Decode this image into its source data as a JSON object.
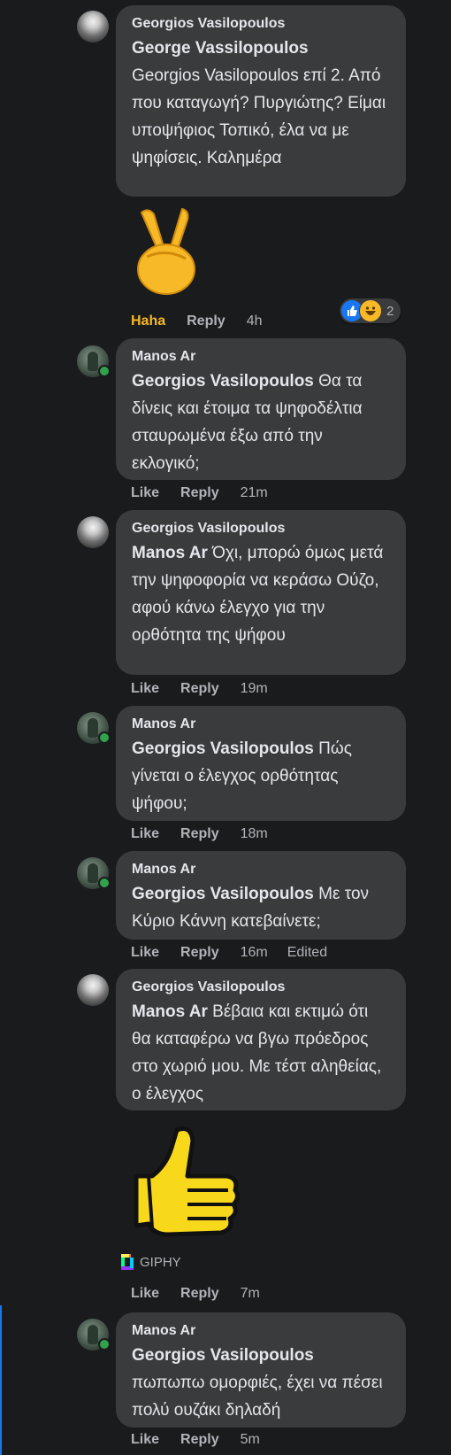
{
  "comments": [
    {
      "author": "Georgios Vasilopoulos",
      "mention": "George Vassilopoulos",
      "text": "Georgios Vasilopoulos επί 2. Από που καταγωγή? Πυργιώτης? Είμαι υποψήφιος Τοπικό, έλα να με ψηφίσεις. Καλημέρα",
      "actions": {
        "react": "Haha",
        "reply": "Reply",
        "time": "4h"
      },
      "reaction_count": "2"
    },
    {
      "author": "Manos Ar",
      "mention": "Georgios Vasilopoulos",
      "text": "Θα τα δίνεις και έτοιμα τα ψηφοδέλτια σταυρωμένα έξω από την εκλογικό;",
      "actions": {
        "react": "Like",
        "reply": "Reply",
        "time": "21m"
      }
    },
    {
      "author": "Georgios Vasilopoulos",
      "mention": "Manos Ar",
      "text": "Όχι, μπορώ όμως μετά την ψηφοφορία να κεράσω Ούζο, αφού κάνω έλεγχο για την ορθότητα της ψήφου",
      "actions": {
        "react": "Like",
        "reply": "Reply",
        "time": "19m"
      }
    },
    {
      "author": "Manos Ar",
      "mention": "Georgios Vasilopoulos",
      "text": "Πώς γίνεται ο έλεγχος ορθότητας ψήφου;",
      "actions": {
        "react": "Like",
        "reply": "Reply",
        "time": "18m"
      }
    },
    {
      "author": "Manos Ar",
      "mention": "Georgios Vasilopoulos",
      "text": "Με τον Κύριο Κάννη κατεβαίνετε;",
      "actions": {
        "react": "Like",
        "reply": "Reply",
        "time": "16m",
        "edited": "Edited"
      }
    },
    {
      "author": "Georgios Vasilopoulos",
      "mention": "Manos Ar",
      "text": "Βέβαια και εκτιμώ ότι θα καταφέρω να βγω πρόεδρος στο χωριό μου. Με τέστ αληθείας, ο έλεγχος",
      "actions": {
        "react": "Like",
        "reply": "Reply",
        "time": "7m"
      },
      "gif_label": "GIPHY"
    },
    {
      "author": "Manos Ar",
      "mention": "Georgios Vasilopoulos",
      "text": "πωπωπω ομορφιές, έχει να πέσει πολύ ουζάκι δηλαδή",
      "actions": {
        "react": "Like",
        "reply": "Reply",
        "time": "5m"
      }
    }
  ],
  "icons": {
    "victory": "victory-hand-emoji",
    "thumbs": "thumbs-up-gif",
    "like": "like-reaction-icon",
    "haha": "haha-reaction-icon"
  },
  "colors": {
    "background": "#1a1b1d",
    "bubble": "#3a3b3c",
    "haha": "#f7b928",
    "like": "#1877f2",
    "online": "#31a24c"
  }
}
